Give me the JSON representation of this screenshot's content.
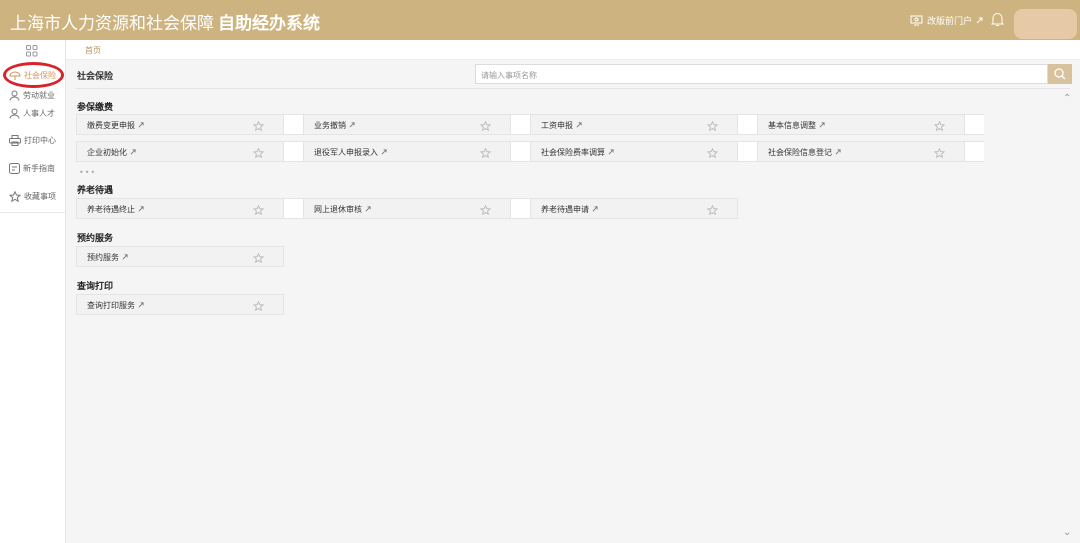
{
  "header": {
    "title": "上海市人力资源和社会保障",
    "subtitle": "自助经办系统",
    "old_portal": "改版前门户"
  },
  "sidebar": {
    "items": [
      {
        "label": "社会保险",
        "icon": "umbrella-icon",
        "active": true
      },
      {
        "label": "劳动就业",
        "icon": "person-icon"
      },
      {
        "label": "人事人才",
        "icon": "person-icon"
      },
      {
        "label": "打印中心",
        "icon": "printer-icon"
      },
      {
        "label": "新手指南",
        "icon": "guide-icon"
      },
      {
        "label": "收藏事项",
        "icon": "star-icon"
      }
    ]
  },
  "breadcrumb": {
    "home": "首页"
  },
  "page": {
    "title": "社会保险"
  },
  "search": {
    "placeholder": "请输入事项名称"
  },
  "sections": [
    {
      "title": "参保缴费",
      "items": [
        "缴费变更申报",
        "业务撤销",
        "工资申报",
        "基本信息调整",
        "企业初始化",
        "退役军人申报录入",
        "社会保险费率调算",
        "社会保险信息登记"
      ],
      "more": "•••"
    },
    {
      "title": "养老待遇",
      "items": [
        "养老待遇终止",
        "网上退休审核",
        "养老待遇申请"
      ]
    },
    {
      "title": "预约服务",
      "items": [
        "预约服务"
      ]
    },
    {
      "title": "查询打印",
      "items": [
        "查询打印服务"
      ]
    }
  ],
  "colors": {
    "header_bg": "#cdb37f",
    "accent": "#d4955a",
    "highlight_circle": "#d9232a"
  }
}
